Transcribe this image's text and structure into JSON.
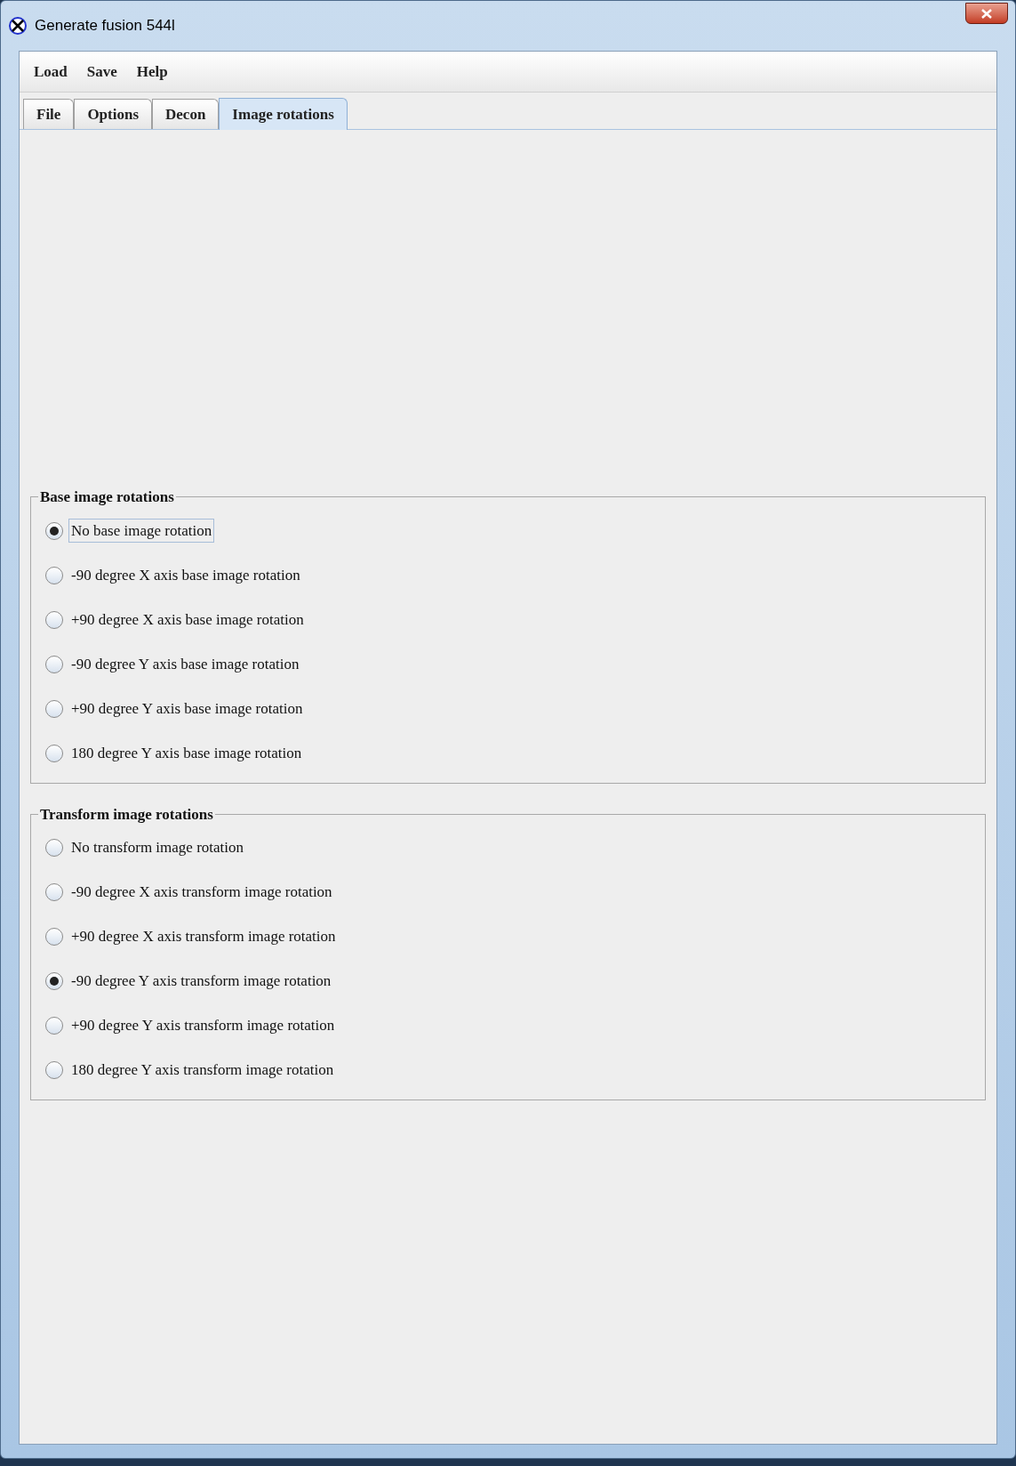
{
  "window": {
    "title": "Generate fusion 544l"
  },
  "menu": [
    "Load",
    "Save",
    "Help"
  ],
  "tabs": [
    {
      "label": "File",
      "selected": false
    },
    {
      "label": "Options",
      "selected": false
    },
    {
      "label": "Decon",
      "selected": false
    },
    {
      "label": "Image rotations",
      "selected": true
    }
  ],
  "groups": [
    {
      "title": "Base image rotations",
      "options": [
        {
          "label": "No base image rotation",
          "selected": true,
          "focused": true
        },
        {
          "label": "-90 degree X axis base image rotation",
          "selected": false,
          "focused": false
        },
        {
          "label": "+90 degree X axis base image rotation",
          "selected": false,
          "focused": false
        },
        {
          "label": "-90 degree Y axis base image rotation",
          "selected": false,
          "focused": false
        },
        {
          "label": "+90 degree Y axis base image rotation",
          "selected": false,
          "focused": false
        },
        {
          "label": "180 degree Y axis base image rotation",
          "selected": false,
          "focused": false
        }
      ]
    },
    {
      "title": "Transform image rotations",
      "options": [
        {
          "label": "No transform image rotation",
          "selected": false,
          "focused": false
        },
        {
          "label": "-90 degree X axis transform image rotation",
          "selected": false,
          "focused": false
        },
        {
          "label": "+90 degree X axis transform image rotation",
          "selected": false,
          "focused": false
        },
        {
          "label": "-90 degree Y axis transform image rotation",
          "selected": true,
          "focused": false
        },
        {
          "label": "+90 degree Y axis transform image rotation",
          "selected": false,
          "focused": false
        },
        {
          "label": "180 degree Y axis transform image rotation",
          "selected": false,
          "focused": false
        }
      ]
    }
  ]
}
